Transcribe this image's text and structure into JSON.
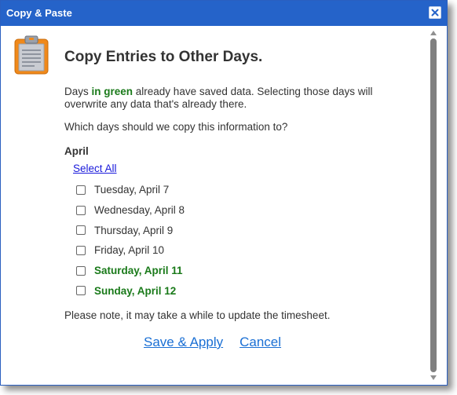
{
  "window": {
    "title": "Copy & Paste",
    "close_icon": "close-icon"
  },
  "header": {
    "icon": "clipboard-icon",
    "title": "Copy Entries to Other Days."
  },
  "intro": {
    "prefix": "Days ",
    "highlight": "in green",
    "suffix": " already have saved data. Selecting those days will overwrite any data that's already there.",
    "highlight_color": "#1a7a1a"
  },
  "question": "Which days should we copy this information to?",
  "month": "April",
  "select_all": "Select All",
  "days": [
    {
      "label": "Tuesday, April 7",
      "checked": false,
      "has_data": false
    },
    {
      "label": "Wednesday, April 8",
      "checked": false,
      "has_data": false
    },
    {
      "label": "Thursday, April 9",
      "checked": false,
      "has_data": false
    },
    {
      "label": "Friday, April 10",
      "checked": false,
      "has_data": false
    },
    {
      "label": "Saturday, April 11",
      "checked": false,
      "has_data": true
    },
    {
      "label": "Sunday, April 12",
      "checked": false,
      "has_data": true
    }
  ],
  "note": "Please note, it may take a while to update the timesheet.",
  "actions": {
    "save_label": "Save & Apply",
    "cancel_label": "Cancel"
  },
  "colors": {
    "titlebar": "#2563c9",
    "link": "#1a6fd4",
    "green": "#1a7a1a"
  }
}
